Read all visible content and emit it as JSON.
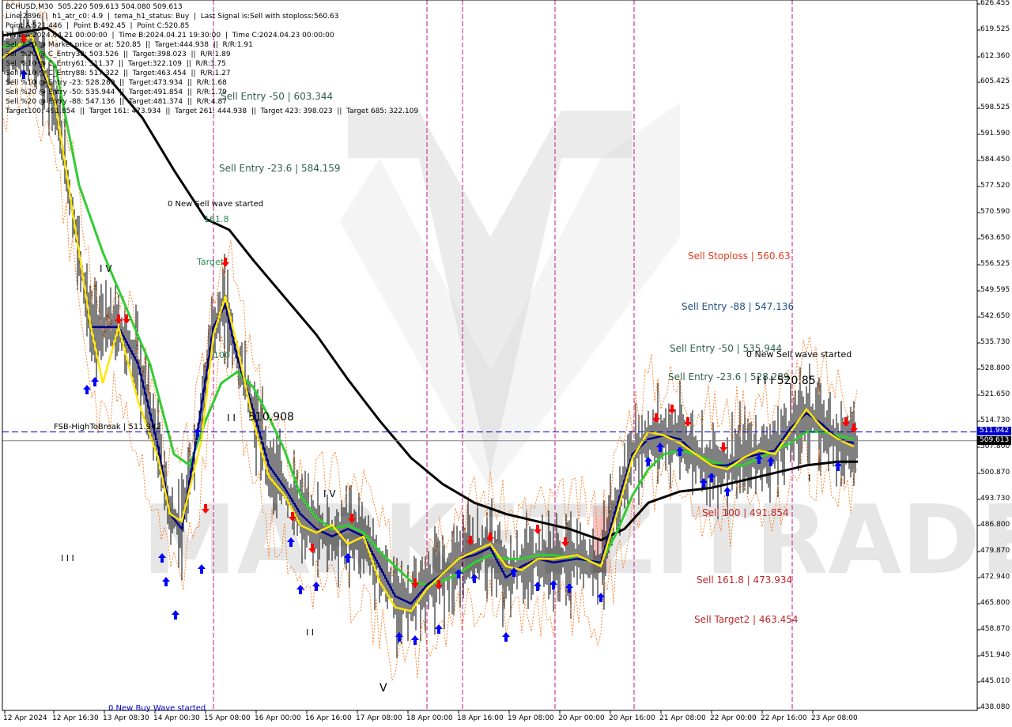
{
  "window": {
    "symbol": "BCHUSD,M30"
  },
  "info_lines": [
    "BCHUSD,M30  505.220 509.613 504.080 509.613",
    "Line:2896  |  h1_atr_c0: 4.9  |  tema_h1_status: Buy  |  Last Signal is:Sell with stoploss:560.63",
    "Point A:521.446  |  Point B:492.45  |  Point C:520.85",
    "Time A:2024.04.21 00:00:00  |  Time B:2024.04.21 19:30:00  |  Time C:2024.04.23 00:00:00",
    "Sell %20 @ Market price or at: 520.85  ||  Target:444.938  ||  R/R:1.91",
    "Sell %20 @ C_Entry38: 503.526  ||  Target:398.023  ||  R/R:1.89",
    "Sell %10 @ C_Entry61: 511.37  ||  Target:322.109  ||  R/R:3.75",
    "Sell %10 @ C_Entry88: 517.322  ||  Target:463.454  ||  R/R:1.27",
    "Sell %10 @ Entry -23: 528.289  ||  Target:473.934  ||  R/R:1.68",
    "Sell %20 @ Entry -50: 535.944  ||  Target:491.854  ||  R/R:1.79",
    "Sell %20 @ Entry -88: 547.136  ||  Target:481.374  ||  R/R:4.87",
    "Target100: 491.854  ||  Target 161: 473.934  ||  Target 261: 444.938  ||  Target 423: 398.023  ||  Target 685: 322.109"
  ],
  "y_ticks": [
    "626.455",
    "619.525",
    "612.360",
    "605.425",
    "598.525",
    "591.590",
    "584.450",
    "577.520",
    "570.590",
    "563.650",
    "556.525",
    "549.595",
    "542.650",
    "535.730",
    "528.800",
    "521.650",
    "514.730",
    "507.800",
    "500.870",
    "493.730",
    "486.800",
    "479.870",
    "472.940",
    "465.800",
    "458.870",
    "451.940",
    "445.010",
    "438.080"
  ],
  "x_ticks": [
    "12 Apr 2024",
    "12 Apr 16:30",
    "13 Apr 08:30",
    "14 Apr 00:30",
    "15 Apr 08:00",
    "16 Apr 00:00",
    "16 Apr 16:00",
    "17 Apr 08:00",
    "18 Apr 00:00",
    "18 Apr 16:00",
    "19 Apr 08:00",
    "20 Apr 00:00",
    "20 Apr 16:00",
    "21 Apr 08:00",
    "22 Apr 00:00",
    "22 Apr 16:00",
    "23 Apr 08:00"
  ],
  "price_tags": {
    "fsb": "511.942",
    "current": "509.613"
  },
  "annotations": [
    {
      "text": "Sell Entry -50 | 603.344",
      "color": "#2f5f4f"
    },
    {
      "text": "Sell Entry -23.6 | 584.159",
      "color": "#2f5f4f"
    },
    {
      "text": "0 New Sell wave started",
      "color": "#000000"
    },
    {
      "text": "161.8",
      "color": "#2e8b57"
    },
    {
      "text": "Target",
      "color": "#2e8b57"
    },
    {
      "text": "100",
      "color": "#2e8b57"
    },
    {
      "text": "I V",
      "color": "#000000"
    },
    {
      "text": "I I",
      "color": "#000000"
    },
    {
      "text": "510.908",
      "color": "#000000"
    },
    {
      "text": "I V",
      "color": "#000000"
    },
    {
      "text": "I I I",
      "color": "#000000"
    },
    {
      "text": "I I",
      "color": "#000000"
    },
    {
      "text": "V",
      "color": "#000000"
    },
    {
      "text": "FSB-HighToBreak  |  511.942",
      "color": "#000000"
    },
    {
      "text": "0 New Buy Wave started",
      "color": "#0000cd"
    },
    {
      "text": "Sell Stoploss | 560.63",
      "color": "#e03c1e"
    },
    {
      "text": "Sell Entry -88 | 547.136",
      "color": "#1f4f7f"
    },
    {
      "text": "Sell Entry -50 | 535.944",
      "color": "#2f5f4f"
    },
    {
      "text": "0 New Sell wave started",
      "color": "#000000"
    },
    {
      "text": "Sell Entry -23.6 | 528.289",
      "color": "#2f5f4f"
    },
    {
      "text": "I I I  520.85",
      "color": "#000000"
    },
    {
      "text": "Sell 100 | 491.854",
      "color": "#c0282a"
    },
    {
      "text": "Sell 161.8 | 473.934",
      "color": "#c0282a"
    },
    {
      "text": "Sell Target2 | 463.454",
      "color": "#c0282a"
    },
    {
      "text": "I",
      "color": "#000000"
    }
  ],
  "colors": {
    "ema_fast": "#ffe600",
    "ema_mid": "#00008b",
    "ema_green": "#32cd32",
    "ema_slow": "#000000",
    "envelope": "#ff6a00",
    "vline": "#c71585",
    "fsb_line": "#0000cd",
    "buy_arrow": "#0000ff",
    "sell_arrow": "#ff0000",
    "watermark": "#d3d3d3"
  },
  "chart_data": {
    "type": "line",
    "title": "BCHUSD,M30",
    "xlabel": "",
    "ylabel": "",
    "ylim": [
      438.08,
      626.455
    ],
    "categories": [
      "12 Apr 2024",
      "12 Apr 16:30",
      "13 Apr 08:30",
      "14 Apr 00:30",
      "15 Apr 08:00",
      "16 Apr 00:00",
      "16 Apr 16:00",
      "17 Apr 08:00",
      "18 Apr 00:00",
      "18 Apr 16:00",
      "19 Apr 08:00",
      "20 Apr 00:00",
      "20 Apr 16:00",
      "21 Apr 08:00",
      "22 Apr 00:00",
      "22 Apr 16:00",
      "23 Apr 08:00"
    ],
    "series": [
      {
        "values": [
          615,
          600,
          540,
          488,
          545,
          505,
          482,
          480,
          462,
          478,
          476,
          478,
          510,
          508,
          503,
          518,
          509.6
        ]
      },
      {
        "values": [
          612,
          595,
          545,
          490,
          540,
          510,
          485,
          482,
          464,
          475,
          474,
          477,
          508,
          510,
          504,
          516,
          510
        ]
      },
      {
        "values": [
          612,
          600,
          560,
          510,
          530,
          515,
          495,
          485,
          470,
          475,
          475,
          478,
          500,
          510,
          506,
          514,
          510
        ]
      },
      {
        "values": [
          620,
          612,
          600,
          585,
          555,
          540,
          520,
          505,
          495,
          490,
          488,
          485,
          487,
          497,
          500,
          504,
          507
        ]
      }
    ],
    "horizontal_lines": [
      {
        "value": 511.942
      },
      {
        "value": 509.613
      }
    ]
  }
}
